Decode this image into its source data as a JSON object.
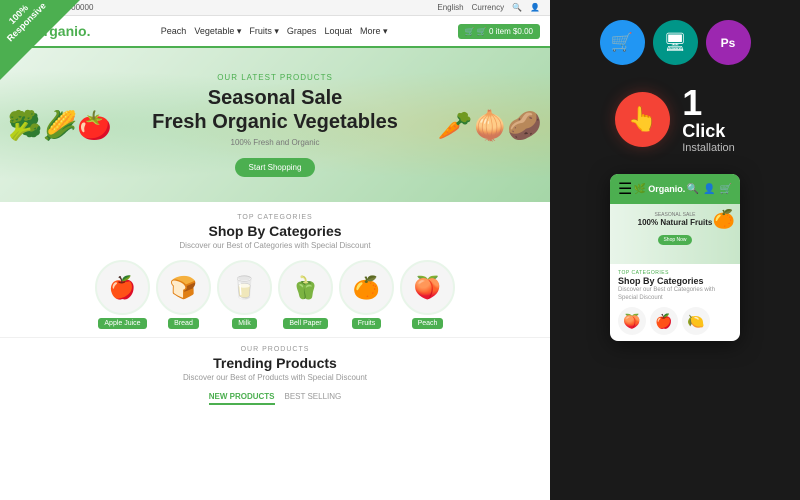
{
  "badge": {
    "text": "100%\nResponsive"
  },
  "topbar": {
    "phone": "Call us: +00-000-00000",
    "language": "English",
    "currency": "Currency"
  },
  "nav": {
    "logo": "Organio.",
    "links": [
      "Peach",
      "Vegetable ▾",
      "Fruits ▾",
      "Grapes",
      "Loquat",
      "More ▾"
    ],
    "cart_count": "0",
    "cart_amount": "$0.00",
    "cart_label": "🛒 0 item $0.00"
  },
  "hero": {
    "subtitle": "OUR LATEST PRODUCTS",
    "title_line1": "Seasonal Sale",
    "title_line2": "Fresh Organic Vegetables",
    "description": "100% Fresh and Organic",
    "cta_label": "Start Shopping"
  },
  "categories": {
    "subtitle": "TOP CATEGORIES",
    "title": "Shop By Categories",
    "description": "Discover our Best of Categories with Special Discount",
    "items": [
      {
        "label": "Apple Juice",
        "emoji": "🍎"
      },
      {
        "label": "Bread",
        "emoji": "🍞"
      },
      {
        "label": "Milk",
        "emoji": "🥛"
      },
      {
        "label": "Bell Paper",
        "emoji": "🫑"
      },
      {
        "label": "Fruits",
        "emoji": "🍊"
      },
      {
        "label": "Peach",
        "emoji": "🍑"
      }
    ]
  },
  "trending": {
    "subtitle": "OUR PRODUCTS",
    "title": "Trending Products",
    "description": "Discover our Best of Products with Special Discount",
    "tab_new": "NEW PRODUCTS",
    "tab_best": "BEST SELLING"
  },
  "right_panel": {
    "icons": [
      {
        "name": "cart-icon",
        "symbol": "🛒",
        "color": "#2196f3"
      },
      {
        "name": "monitor-icon",
        "symbol": "🖥",
        "color": "#009688"
      },
      {
        "name": "photoshop-icon",
        "symbol": "Ps",
        "color": "#9c27b0"
      }
    ],
    "install_icon": "👆",
    "install_number": "1",
    "install_label": "Click",
    "install_sub": "Installation"
  },
  "mobile_mockup": {
    "logo": "Organio.",
    "hero_sub": "Seasonal Sale",
    "hero_title": "100% Natural Fruits",
    "hero_btn": "Shop Now",
    "categories_sub": "TOP CATEGORIES",
    "categories_title": "Shop By Categories",
    "categories_desc": "Discover our Best of Categories with Special Discount"
  }
}
